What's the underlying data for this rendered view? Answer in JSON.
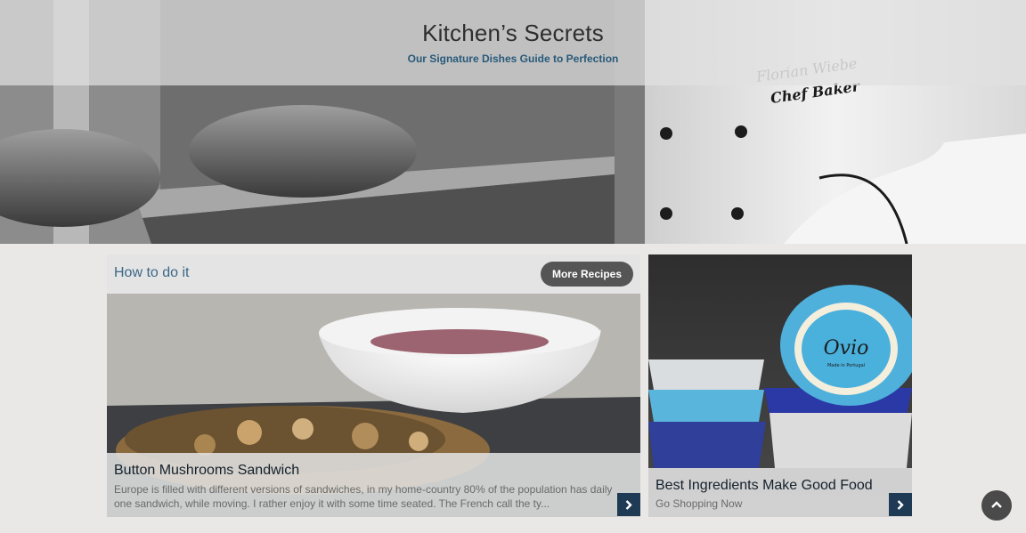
{
  "header": {
    "title": "Kitchen’s Secrets",
    "subtitle": "Our Signature Dishes Guide to Perfection",
    "banner_image_text": "Florian Wiebe Chef Baker"
  },
  "recipes_section": {
    "heading": "How to do it",
    "more_button_label": "More Recipes",
    "featured": {
      "title": "Button Mushrooms Sandwich",
      "excerpt": "Europe is filled with different versions of sandwiches, in my home-country 80% of the population has daily one sandwich, while moving. I rather enjoy it with some time seated. The French call the ty..."
    }
  },
  "promo": {
    "title": "Best Ingredients Make Good Food",
    "link_text": "Go Shopping Now",
    "bowl_logo_text": "Ovio",
    "bowl_logo_subtext": "Made in Portugal"
  },
  "icons": {
    "arrow": "chevron-right-icon",
    "back_to_top": "chevron-up-icon"
  },
  "colors": {
    "accent_blue": "#285a7a",
    "dark_navy": "#1f3a54",
    "button_gray": "#555555",
    "page_background": "#e9e8e6"
  }
}
